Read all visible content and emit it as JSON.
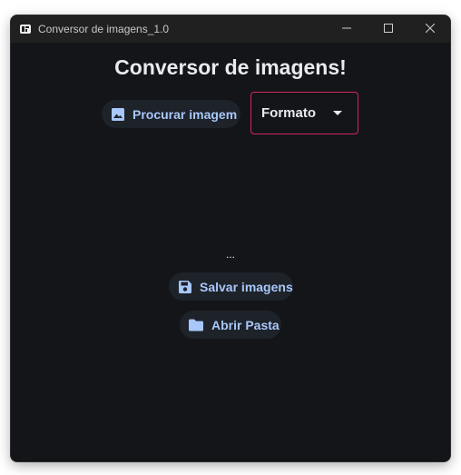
{
  "window": {
    "title": "Conversor de imagens_1.0",
    "app_icon": "app-logo-icon",
    "controls": [
      "minimize-icon",
      "maximize-icon",
      "close-icon"
    ]
  },
  "main": {
    "heading": "Conversor de imagens!",
    "browse_button": {
      "label": "Procurar imagem",
      "icon": "image-icon"
    },
    "format_dropdown": {
      "selected": "Formato",
      "icon": "caret-down-icon"
    },
    "status_text": "...",
    "save_button": {
      "label": "Salvar imagens",
      "icon": "floppy-disk-icon"
    },
    "open_folder_button": {
      "label": "Abrir Pasta",
      "icon": "folder-icon"
    }
  },
  "colors": {
    "background": "#131519",
    "titlebar": "#202020",
    "accent_text": "#a8c7fa",
    "dropdown_border": "#d0275c",
    "button_bg": "#1e2229"
  }
}
